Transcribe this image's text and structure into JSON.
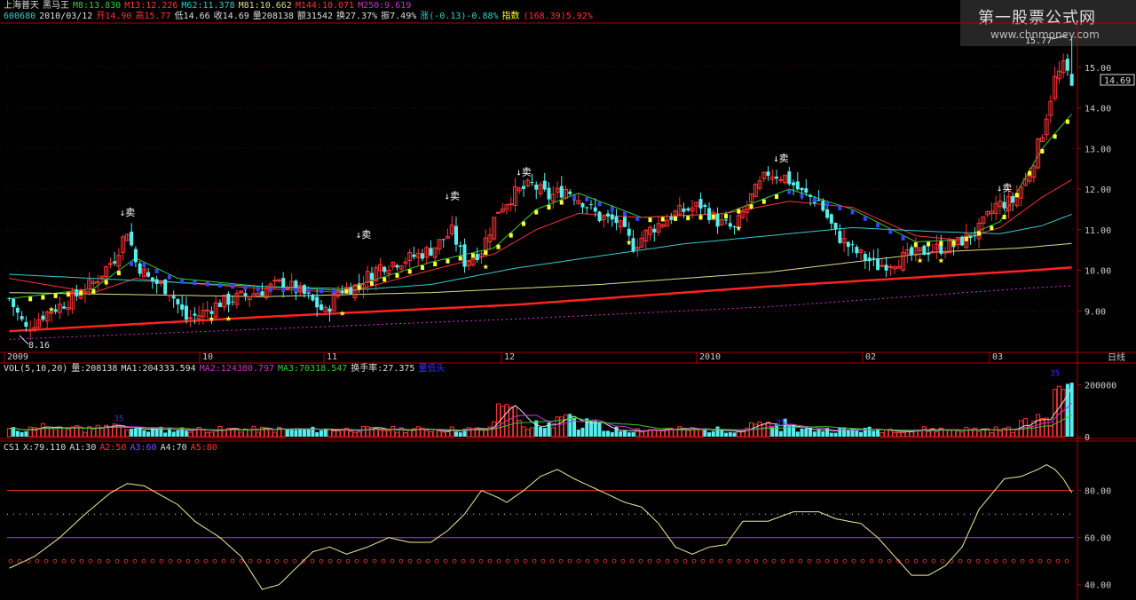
{
  "header": {
    "exchange": "上海普天",
    "indicator_name": "黑马王",
    "ma_items": [
      {
        "label": "M8:13.830",
        "color": "#33cc33"
      },
      {
        "label": "M13:12.226",
        "color": "#ff3333"
      },
      {
        "label": "M62:11.378",
        "color": "#33cccc"
      },
      {
        "label": "M81:10.662",
        "color": "#dddd88"
      },
      {
        "label": "M144:10.071",
        "color": "#ff3333"
      },
      {
        "label": "M250:9.619",
        "color": "#cc33cc"
      }
    ],
    "code": "600680",
    "date": "2010/03/12",
    "quote_items": [
      {
        "label": "开14.90",
        "color": "#ff3333"
      },
      {
        "label": "高15.77",
        "color": "#ff3333"
      },
      {
        "label": "低14.66",
        "color": "#dddddd"
      },
      {
        "label": "收14.69",
        "color": "#dddddd"
      },
      {
        "label": "量208138",
        "color": "#dddddd"
      },
      {
        "label": "额31542",
        "color": "#dddddd"
      },
      {
        "label": "换27.37%",
        "color": "#dddddd"
      },
      {
        "label": "振7.49%",
        "color": "#dddddd"
      },
      {
        "label": "涨(-0.13)-0.88%",
        "color": "#33cccc"
      },
      {
        "label": "指数",
        "color": "#ffff00"
      },
      {
        "label": "(168.39)5.92%",
        "color": "#ff3333"
      }
    ]
  },
  "watermark": {
    "title": "第一股票公式网",
    "url": "www.chnmoney.com"
  },
  "vol_header": [
    {
      "label": "VOL(5,10,20)",
      "color": "#dddddd"
    },
    {
      "label": "量:208138",
      "color": "#dddddd"
    },
    {
      "label": "MA1:204333.594",
      "color": "#dddddd"
    },
    {
      "label": "MA2:124380.797",
      "color": "#cc33cc"
    },
    {
      "label": "MA3:70318.547",
      "color": "#33cc33"
    },
    {
      "label": "换手率:27.375",
      "color": "#dddddd"
    },
    {
      "label": "量低头",
      "color": "#3333ff"
    }
  ],
  "osc_header": [
    {
      "label": "CS1",
      "color": "#dddddd"
    },
    {
      "label": "X:79.110",
      "color": "#dddddd"
    },
    {
      "label": "A1:30",
      "color": "#dddddd"
    },
    {
      "label": "A2:50",
      "color": "#ff3333"
    },
    {
      "label": "A3:60",
      "color": "#8844ff"
    },
    {
      "label": "A4:70",
      "color": "#dddddd"
    },
    {
      "label": "A5:80",
      "color": "#ff3333"
    }
  ],
  "chart_data": [
    {
      "type": "candlestick",
      "name": "price",
      "ylim": [
        8.0,
        16.0
      ],
      "y_ticks": [
        "15.00",
        "14.00",
        "13.00",
        "12.00",
        "11.00",
        "10.00",
        "9.00"
      ],
      "x_labels": [
        "2009",
        "10",
        "11",
        "12",
        "2010",
        "02",
        "03"
      ],
      "period_label": "日线",
      "current_price": "14.69",
      "high_label": "15.77",
      "low_label": "8.16",
      "signal_text": "↓卖",
      "star_text": "★",
      "sell_signals": [
        {
          "index": 28,
          "price": 10.95
        },
        {
          "index": 84,
          "price": 10.4
        },
        {
          "index": 105,
          "price": 11.35
        },
        {
          "index": 122,
          "price": 11.95
        },
        {
          "index": 183,
          "price": 12.28
        },
        {
          "index": 236,
          "price": 11.55
        }
      ],
      "stars": [
        {
          "index": 10,
          "price": 9.15
        },
        {
          "index": 48,
          "price": 8.92
        },
        {
          "index": 52,
          "price": 8.92
        },
        {
          "index": 79,
          "price": 9.05
        },
        {
          "index": 113,
          "price": 10.2
        },
        {
          "index": 147,
          "price": 10.8
        },
        {
          "index": 173,
          "price": 11.15
        },
        {
          "index": 216,
          "price": 10.35
        },
        {
          "index": 221,
          "price": 10.35
        }
      ],
      "ma_lines": [
        {
          "name": "M8",
          "color": "#33cc33",
          "anchors": [
            [
              0,
              9.3
            ],
            [
              20,
              9.55
            ],
            [
              30,
              10.3
            ],
            [
              40,
              9.8
            ],
            [
              60,
              9.6
            ],
            [
              80,
              9.55
            ],
            [
              100,
              10.2
            ],
            [
              115,
              10.55
            ],
            [
              125,
              11.5
            ],
            [
              135,
              11.9
            ],
            [
              150,
              11.3
            ],
            [
              170,
              11.4
            ],
            [
              185,
              12.0
            ],
            [
              200,
              11.5
            ],
            [
              215,
              10.7
            ],
            [
              225,
              10.75
            ],
            [
              235,
              11.2
            ],
            [
              245,
              13.0
            ],
            [
              252,
              13.85
            ]
          ]
        },
        {
          "name": "M13",
          "color": "#ff3333",
          "anchors": [
            [
              0,
              9.8
            ],
            [
              20,
              9.45
            ],
            [
              30,
              9.8
            ],
            [
              40,
              9.7
            ],
            [
              60,
              9.55
            ],
            [
              80,
              9.45
            ],
            [
              100,
              10.0
            ],
            [
              115,
              10.4
            ],
            [
              125,
              11.0
            ],
            [
              135,
              11.4
            ],
            [
              150,
              11.3
            ],
            [
              170,
              11.4
            ],
            [
              185,
              11.7
            ],
            [
              200,
              11.55
            ],
            [
              215,
              10.85
            ],
            [
              225,
              10.75
            ],
            [
              235,
              11.05
            ],
            [
              245,
              11.8
            ],
            [
              252,
              12.23
            ]
          ]
        },
        {
          "name": "M62",
          "color": "#33cccc",
          "anchors": [
            [
              0,
              9.9
            ],
            [
              40,
              9.7
            ],
            [
              80,
              9.5
            ],
            [
              100,
              9.65
            ],
            [
              120,
              10.05
            ],
            [
              140,
              10.35
            ],
            [
              160,
              10.65
            ],
            [
              190,
              10.95
            ],
            [
              200,
              11.05
            ],
            [
              220,
              10.95
            ],
            [
              235,
              10.9
            ],
            [
              245,
              11.1
            ],
            [
              252,
              11.38
            ]
          ]
        },
        {
          "name": "M81",
          "color": "#dddd88",
          "anchors": [
            [
              0,
              9.45
            ],
            [
              60,
              9.35
            ],
            [
              100,
              9.45
            ],
            [
              140,
              9.65
            ],
            [
              180,
              9.95
            ],
            [
              200,
              10.2
            ],
            [
              220,
              10.45
            ],
            [
              240,
              10.55
            ],
            [
              252,
              10.66
            ]
          ]
        },
        {
          "name": "M144",
          "color": "#ff2222",
          "anchors": [
            [
              0,
              8.5
            ],
            [
              60,
              8.85
            ],
            [
              120,
              9.15
            ],
            [
              180,
              9.6
            ],
            [
              240,
              9.98
            ],
            [
              252,
              10.07
            ]
          ]
        },
        {
          "name": "M250",
          "color": "#cc33cc",
          "anchors": [
            [
              0,
              8.3
            ],
            [
              60,
              8.55
            ],
            [
              120,
              8.8
            ],
            [
              180,
              9.1
            ],
            [
              240,
              9.55
            ],
            [
              252,
              9.62
            ]
          ]
        }
      ],
      "close_anchors": [
        [
          0,
          9.3
        ],
        [
          4,
          8.55
        ],
        [
          8,
          8.9
        ],
        [
          15,
          9.3
        ],
        [
          20,
          9.7
        ],
        [
          25,
          10.3
        ],
        [
          28,
          11.0
        ],
        [
          30,
          10.2
        ],
        [
          33,
          9.8
        ],
        [
          38,
          9.5
        ],
        [
          42,
          8.8
        ],
        [
          45,
          8.9
        ],
        [
          50,
          9.2
        ],
        [
          55,
          9.35
        ],
        [
          60,
          9.5
        ],
        [
          65,
          9.7
        ],
        [
          70,
          9.4
        ],
        [
          75,
          8.95
        ],
        [
          78,
          9.5
        ],
        [
          82,
          9.6
        ],
        [
          88,
          10.1
        ],
        [
          95,
          10.3
        ],
        [
          100,
          10.5
        ],
        [
          105,
          10.95
        ],
        [
          108,
          10.2
        ],
        [
          112,
          10.5
        ],
        [
          116,
          11.5
        ],
        [
          120,
          11.9
        ],
        [
          124,
          12.1
        ],
        [
          128,
          11.8
        ],
        [
          132,
          12.0
        ],
        [
          136,
          11.7
        ],
        [
          140,
          11.3
        ],
        [
          144,
          11.2
        ],
        [
          148,
          10.6
        ],
        [
          152,
          11.0
        ],
        [
          158,
          11.4
        ],
        [
          164,
          11.6
        ],
        [
          168,
          11.2
        ],
        [
          172,
          11.0
        ],
        [
          176,
          11.8
        ],
        [
          180,
          12.4
        ],
        [
          184,
          12.3
        ],
        [
          188,
          11.9
        ],
        [
          192,
          11.7
        ],
        [
          196,
          10.9
        ],
        [
          200,
          10.5
        ],
        [
          206,
          10.1
        ],
        [
          212,
          10.3
        ],
        [
          218,
          10.5
        ],
        [
          224,
          10.6
        ],
        [
          230,
          11.0
        ],
        [
          234,
          11.6
        ],
        [
          238,
          11.7
        ],
        [
          242,
          12.4
        ],
        [
          245,
          13.4
        ],
        [
          248,
          14.7
        ],
        [
          250,
          15.0
        ],
        [
          252,
          14.69
        ]
      ]
    },
    {
      "type": "bar",
      "name": "volume",
      "ylim": [
        0,
        260000
      ],
      "y_ticks": [
        "200000",
        "0"
      ],
      "last_value": 208138,
      "ma_label_text": "35"
    },
    {
      "type": "line",
      "name": "CS1",
      "ylim": [
        35,
        98
      ],
      "y_ticks": [
        "80.00",
        "60.00",
        "40.00"
      ],
      "levels": [
        {
          "value": 30,
          "color": "#dddddd",
          "style": "solid"
        },
        {
          "value": 50,
          "color": "#ff3333",
          "style": "circles"
        },
        {
          "value": 60,
          "color": "#8844ff",
          "style": "solid"
        },
        {
          "value": 70,
          "color": "#dddddd",
          "style": "dotted"
        },
        {
          "value": 80,
          "color": "#ff3333",
          "style": "solid"
        }
      ],
      "anchors": [
        [
          0,
          47
        ],
        [
          6,
          52
        ],
        [
          12,
          60
        ],
        [
          18,
          70
        ],
        [
          24,
          79
        ],
        [
          28,
          83
        ],
        [
          32,
          82
        ],
        [
          36,
          78
        ],
        [
          40,
          74
        ],
        [
          44,
          67
        ],
        [
          50,
          60
        ],
        [
          55,
          52
        ],
        [
          60,
          38
        ],
        [
          64,
          40
        ],
        [
          68,
          47
        ],
        [
          72,
          54
        ],
        [
          76,
          56
        ],
        [
          80,
          53
        ],
        [
          85,
          56
        ],
        [
          90,
          60
        ],
        [
          95,
          58
        ],
        [
          100,
          58
        ],
        [
          104,
          63
        ],
        [
          108,
          70
        ],
        [
          112,
          80
        ],
        [
          116,
          77
        ],
        [
          118,
          75
        ],
        [
          122,
          80
        ],
        [
          126,
          86
        ],
        [
          130,
          89
        ],
        [
          134,
          85
        ],
        [
          140,
          80
        ],
        [
          146,
          75
        ],
        [
          150,
          73
        ],
        [
          154,
          66
        ],
        [
          158,
          56
        ],
        [
          162,
          53
        ],
        [
          166,
          56
        ],
        [
          170,
          57
        ],
        [
          174,
          67
        ],
        [
          180,
          67
        ],
        [
          186,
          71
        ],
        [
          192,
          71
        ],
        [
          196,
          68
        ],
        [
          202,
          66
        ],
        [
          206,
          60
        ],
        [
          210,
          52
        ],
        [
          214,
          44
        ],
        [
          218,
          44
        ],
        [
          222,
          48
        ],
        [
          226,
          56
        ],
        [
          230,
          72
        ],
        [
          236,
          85
        ],
        [
          240,
          86
        ],
        [
          244,
          89
        ],
        [
          246,
          91
        ],
        [
          248,
          89
        ],
        [
          250,
          85
        ],
        [
          252,
          79.11
        ]
      ],
      "current": 79.11
    }
  ]
}
